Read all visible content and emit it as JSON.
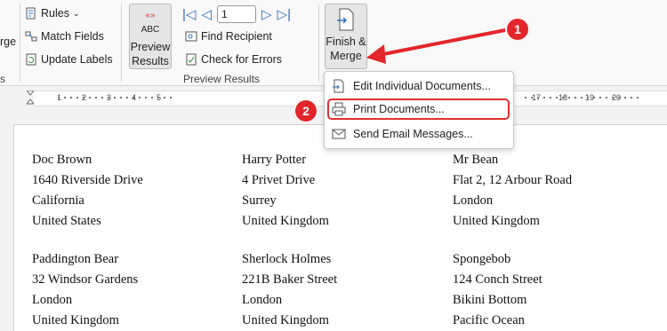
{
  "ribbon": {
    "write_insert": {
      "rules": "Rules",
      "merge_partial": "rge",
      "match_fields": "Match Fields",
      "update_labels": "Update Labels",
      "group_partial": "s"
    },
    "preview": {
      "preview_results_line1": "Preview",
      "preview_results_line2": "Results",
      "abc": "ABC",
      "record_number": "1",
      "find_recipient": "Find Recipient",
      "check_errors": "Check for Errors",
      "group_label": "Preview Results"
    },
    "finish": {
      "line1": "Finish &",
      "line2": "Merge"
    }
  },
  "menu": {
    "items": [
      {
        "label": "Edit Individual Documents...",
        "icon": "edit-document-icon"
      },
      {
        "label": "Print Documents...",
        "icon": "printer-icon"
      },
      {
        "label": "Send Email Messages...",
        "icon": "email-icon"
      }
    ]
  },
  "ruler": {
    "left_numbers": [
      "1",
      "2",
      "3",
      "4",
      "5"
    ],
    "right_numbers": [
      "17",
      "18",
      "19",
      "20"
    ]
  },
  "annotations": {
    "badge1": "1",
    "badge2": "2",
    "badge_color": "#e2262b"
  },
  "labels": [
    [
      "Doc Brown",
      "1640 Riverside Drive",
      "California",
      "United States"
    ],
    [
      "Harry Potter",
      "4 Privet Drive",
      "Surrey",
      "United Kingdom"
    ],
    [
      "Mr Bean",
      "Flat 2, 12 Arbour Road",
      "London",
      "United Kingdom"
    ],
    [
      "Paddington Bear",
      "32 Windsor Gardens",
      "London",
      "United Kingdom"
    ],
    [
      "Sherlock Holmes",
      "221B Baker Street",
      "London",
      "United Kingdom"
    ],
    [
      "Spongebob",
      "124 Conch Street",
      "Bikini Bottom",
      "Pacific Ocean"
    ]
  ]
}
